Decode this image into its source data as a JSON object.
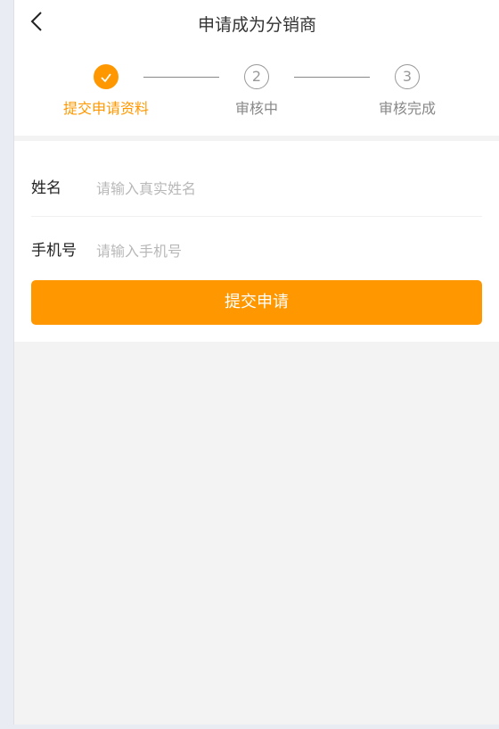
{
  "header": {
    "title": "申请成为分销商",
    "back_icon": "chevron-left-icon"
  },
  "steps": [
    {
      "label": "提交申请资料",
      "status": "done",
      "icon": "check-icon"
    },
    {
      "label": "审核中",
      "number": "2",
      "status": "pending"
    },
    {
      "label": "审核完成",
      "number": "3",
      "status": "pending"
    }
  ],
  "form": {
    "name": {
      "label": "姓名",
      "placeholder": "请输入真实姓名",
      "value": ""
    },
    "phone": {
      "label": "手机号",
      "placeholder": "请输入手机号",
      "value": ""
    },
    "submit_label": "提交申请"
  },
  "colors": {
    "accent": "#ff9800",
    "inactive": "#999999",
    "background": "#f3f3f3"
  }
}
